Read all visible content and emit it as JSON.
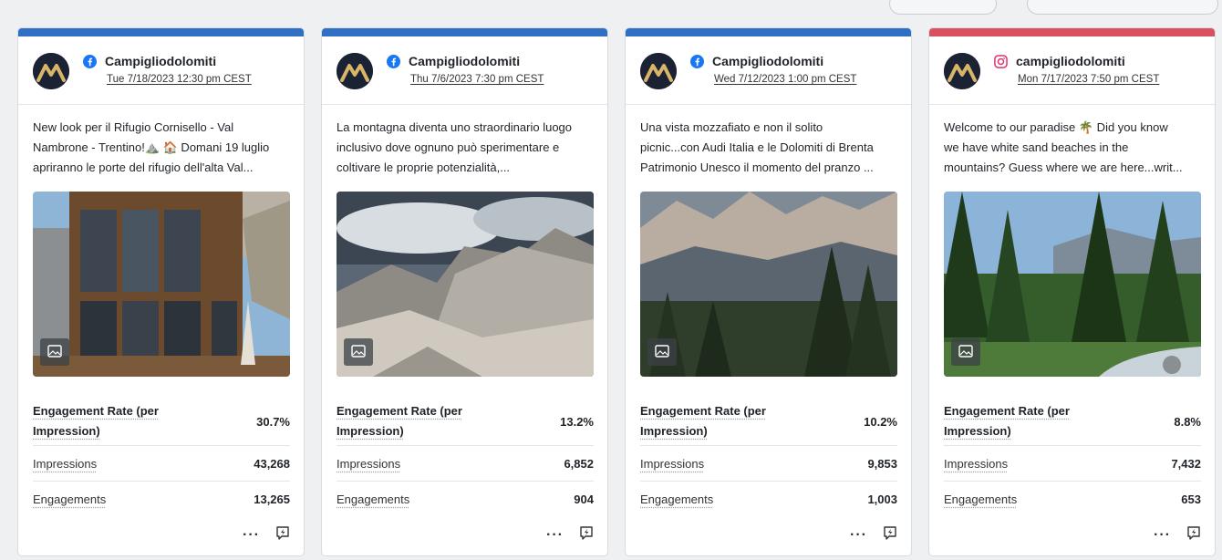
{
  "cards": [
    {
      "bar_color": "#2f6fc4",
      "network": "facebook-icon",
      "account": "Campigliodolomiti",
      "date": "Tue 7/18/2023 12:30 pm CEST",
      "text_lines": [
        "New look per il Rifugio Cornisello - Val",
        "Nambrone - Trentino!⛰️ 🏠 Domani 19 luglio",
        "apriranno le porte del rifugio dell'alta Val..."
      ],
      "metrics": [
        {
          "label": "Engagement Rate (per Impression)",
          "value": "30.7%"
        },
        {
          "label": "Impressions",
          "value": "43,268"
        },
        {
          "label": "Engagements",
          "value": "13,265"
        }
      ]
    },
    {
      "bar_color": "#2f6fc4",
      "network": "facebook-icon",
      "account": "Campigliodolomiti",
      "date": "Thu 7/6/2023 7:30 pm CEST",
      "text_lines": [
        "La montagna diventa uno straordinario luogo",
        "inclusivo dove ognuno può sperimentare e",
        "coltivare le proprie potenzialità,..."
      ],
      "metrics": [
        {
          "label": "Engagement Rate (per Impression)",
          "value": "13.2%"
        },
        {
          "label": "Impressions",
          "value": "6,852"
        },
        {
          "label": "Engagements",
          "value": "904"
        }
      ]
    },
    {
      "bar_color": "#2f6fc4",
      "network": "facebook-icon",
      "account": "Campigliodolomiti",
      "date": "Wed 7/12/2023 1:00 pm CEST",
      "text_lines": [
        "Una vista mozzafiato e non il solito",
        "picnic...con Audi Italia e le Dolomiti di Brenta",
        "Patrimonio Unesco il momento del pranzo ..."
      ],
      "metrics": [
        {
          "label": "Engagement Rate (per Impression)",
          "value": "10.2%"
        },
        {
          "label": "Impressions",
          "value": "9,853"
        },
        {
          "label": "Engagements",
          "value": "1,003"
        }
      ]
    },
    {
      "bar_color": "#d9505f",
      "network": "instagram-icon",
      "account": "campigliodolomiti",
      "date": "Mon 7/17/2023 7:50 pm CEST",
      "text_lines": [
        "Welcome to our paradise 🌴 Did you know",
        "we have white sand beaches in the",
        "mountains? Guess where we are here...writ..."
      ],
      "metrics": [
        {
          "label": "Engagement Rate (per Impression)",
          "value": "8.8%"
        },
        {
          "label": "Impressions",
          "value": "7,432"
        },
        {
          "label": "Engagements",
          "value": "653"
        }
      ]
    }
  ],
  "actions": {
    "more": "···"
  }
}
